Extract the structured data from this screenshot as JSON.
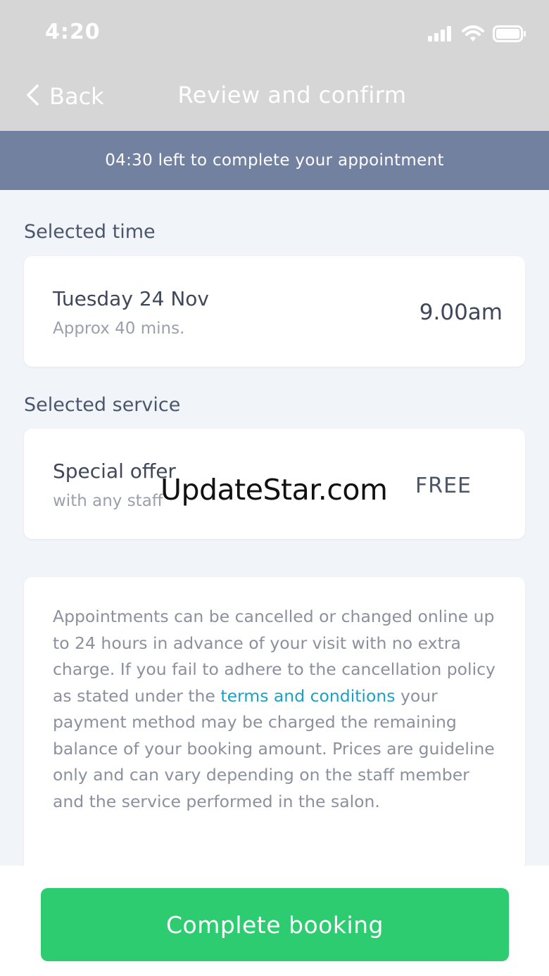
{
  "status_bar": {
    "time": "4:20",
    "signal_icon": "cellular-signal-icon",
    "wifi_icon": "wifi-icon",
    "battery_icon": "battery-icon"
  },
  "nav": {
    "back_label": "Back",
    "back_icon": "chevron-left-icon",
    "title": "Review and confirm"
  },
  "countdown": {
    "text": "04:30 left to complete your appointment"
  },
  "selected_time": {
    "heading": "Selected time",
    "date": "Tuesday 24 Nov",
    "duration": "Approx 40 mins.",
    "time": "9.00am"
  },
  "selected_service": {
    "heading": "Selected service",
    "name": "Special offer",
    "staff": "with any staff",
    "price": "FREE"
  },
  "watermark": {
    "text": "UpdateStar.com"
  },
  "policy": {
    "text_before": "Appointments can be cancelled or changed online up to 24 hours in advance of your visit with no extra charge. If you fail to adhere to the cancellation policy as stated under the ",
    "link": "terms and conditions",
    "text_after": " your payment method may be charged the remaining balance of your booking amount. Prices are guideline only and can vary depending on the staff member and the service performed in the salon."
  },
  "action": {
    "complete_label": "Complete booking"
  },
  "colors": {
    "header_bg": "#d6d6d6",
    "countdown_bg": "#72819f",
    "page_bg": "#f1f4f9",
    "accent_green": "#2ecc71",
    "link": "#1aa1c8"
  }
}
